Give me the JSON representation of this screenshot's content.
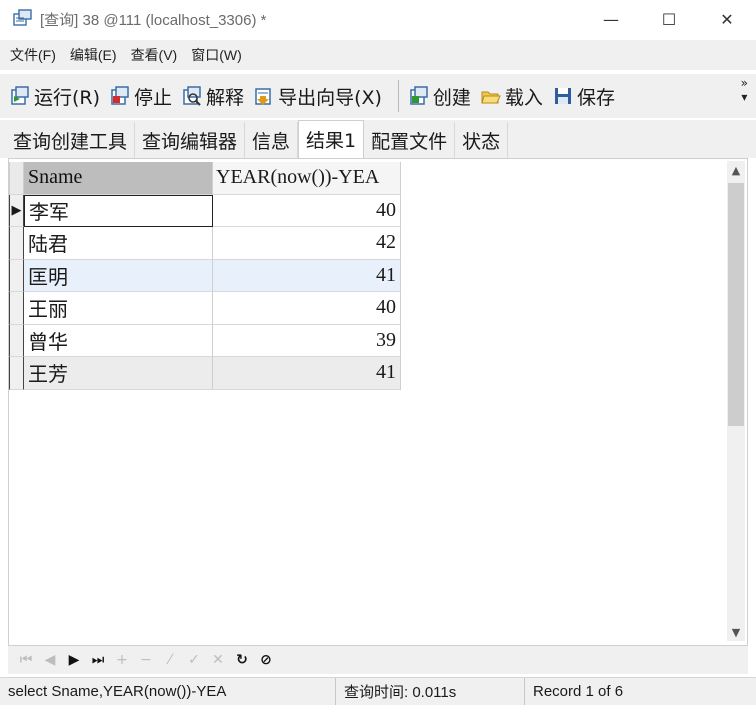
{
  "window": {
    "title": "[查询] 38 @111 (localhost_3306) *",
    "minimize": "—",
    "maximize": "☐",
    "close": "✕"
  },
  "menu": {
    "items": [
      "文件(F)",
      "编辑(E)",
      "查看(V)",
      "窗口(W)"
    ]
  },
  "toolbar": {
    "run": "运行(R)",
    "stop": "停止",
    "explain": "解释",
    "export": "导出向导(X)",
    "create": "创建",
    "load": "载入",
    "save": "保存",
    "more": "»\n▾"
  },
  "tabs": [
    "查询创建工具",
    "查询编辑器",
    "信息",
    "结果1",
    "配置文件",
    "状态"
  ],
  "active_tab": "结果1",
  "grid": {
    "columns": [
      "Sname",
      "YEAR(now())-YEA"
    ],
    "rows": [
      {
        "name": "李军",
        "value": "40"
      },
      {
        "name": "陆君",
        "value": "42"
      },
      {
        "name": "匡明",
        "value": "41"
      },
      {
        "name": "王丽",
        "value": "40"
      },
      {
        "name": "曾华",
        "value": "39"
      },
      {
        "name": "王芳",
        "value": "41"
      }
    ],
    "current_row_marker": "▶"
  },
  "navigator": {
    "first": "⏮",
    "prev": "◀",
    "next": "▶",
    "last": "⏭",
    "add": "+",
    "delete": "−",
    "edit": "⁄",
    "post": "✓",
    "cancel": "✕",
    "refresh": "↻",
    "stop": "⊘"
  },
  "status": {
    "sql": "select Sname,YEAR(now())-YEA",
    "time": "查询时间: 0.011s",
    "record": "Record 1 of 6"
  },
  "colors": {
    "chrome": "#f0f0f0",
    "header_selected": "#bdbdbd",
    "highlight_row": "#e8f1fb",
    "alt_row": "#ececec"
  }
}
